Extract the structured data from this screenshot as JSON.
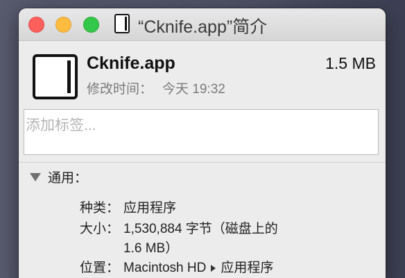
{
  "window": {
    "title": "“Cknife.app”简介"
  },
  "file": {
    "name": "Cknife.app",
    "size": "1.5 MB",
    "modified_label": "修改时间：",
    "modified_value": "今天 19:32"
  },
  "tags": {
    "placeholder": "添加标签..."
  },
  "general": {
    "header": "通用：",
    "kind_label": "种类：",
    "kind_value": "应用程序",
    "size_label": "大小：",
    "size_value_line1": "1,530,884 字节（磁盘上的",
    "size_value_line2": "1.6 MB）",
    "where_label": "位置：",
    "where_volume": "Macintosh HD",
    "where_folder": "应用程序"
  },
  "icons": {
    "title_icon": "app-document-icon",
    "app_icon": "app-document-icon",
    "disclosure": "disclosure-triangle-down-icon",
    "path_separator": "path-arrow-right-icon"
  },
  "colors": {
    "close": "#fc605c",
    "minimize": "#fdbc40",
    "maximize": "#34c84a"
  }
}
